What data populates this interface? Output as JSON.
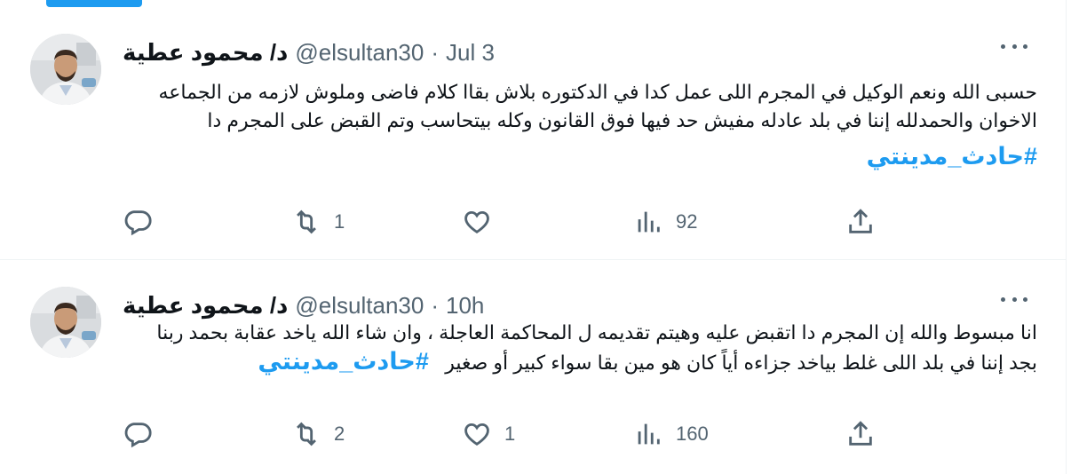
{
  "tweets": [
    {
      "author_name": "د/ محمود عطية",
      "handle": "@elsultan30",
      "separator": "·",
      "time": "Jul 3",
      "lines": [
        "حسبى الله ونعم الوكيل في المجرم اللى عمل كدا في الدكتوره بلاش بقاا كلام فاضى وملوش لازمه من الجماعه",
        "الاخوان والحمدلله إننا في بلد عادله مفيش حد فيها فوق القانون وكله بيتحاسب وتم القبض على المجرم دا"
      ],
      "hashtag": "#حادث_مدينتي",
      "replies": "",
      "retweets": "1",
      "likes": "",
      "views": "92"
    },
    {
      "author_name": "د/ محمود عطية",
      "handle": "@elsultan30",
      "separator": "·",
      "time": "10h",
      "line1": "انا مبسوط والله  إن المجرم دا اتقبض عليه وهيتم تقديمه ل المحاكمة العاجلة  ، وان شاء الله ياخد عقابة بحمد ربنا",
      "line2": "بجد إننا في بلد اللى غلط بياخد جزاءه أياً كان هو مين بقا سواء كبير أو صغير",
      "hashtag": "#حادث_مدينتي",
      "replies": "",
      "retweets": "2",
      "likes": "1",
      "views": "160"
    }
  ],
  "icons": {
    "reply": "reply-icon",
    "retweet": "retweet-icon",
    "like": "heart-icon",
    "views": "views-icon",
    "share": "share-icon",
    "more": "more-icon"
  },
  "colors": {
    "accent": "#1d9bf0",
    "secondary_text": "#536471",
    "primary_text": "#0f1419",
    "divider": "#eff3f4"
  }
}
